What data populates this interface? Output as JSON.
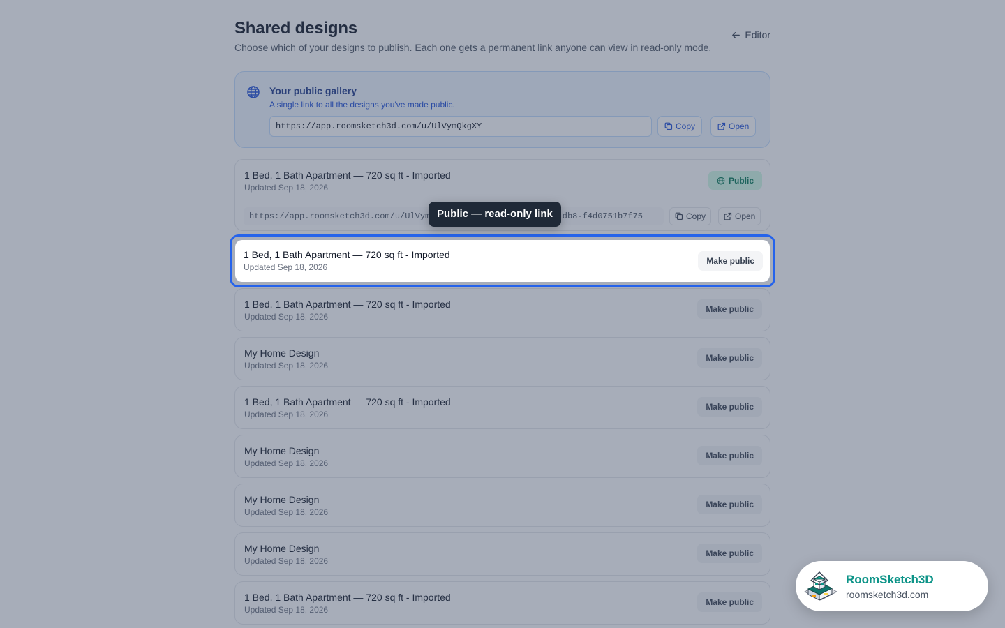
{
  "header": {
    "title": "Shared designs",
    "subtitle": "Choose which of your designs to publish. Each one gets a permanent link anyone can view in read-only mode.",
    "editor_link": "Editor"
  },
  "gallery": {
    "title": "Your public gallery",
    "description": "A single link to all the designs you've made public.",
    "url": "https://app.roomsketch3d.com/u/UlVymQkgXY",
    "copy_label": "Copy",
    "open_label": "Open"
  },
  "designs": [
    {
      "title": "1 Bed, 1 Bath Apartment — 720 sq ft - Imported",
      "updated": "Updated Sep 18, 2026",
      "status": "Public",
      "share_url_start": "https://app.roomsketch3d.com/u/UlVym",
      "share_url_end": "db8-f4d0751b7f75",
      "copy_label": "Copy",
      "open_label": "Open"
    },
    {
      "title": "1 Bed, 1 Bath Apartment — 720 sq ft - Imported",
      "updated": "Updated Sep 18, 2026",
      "action": "Make public"
    },
    {
      "title": "1 Bed, 1 Bath Apartment — 720 sq ft - Imported",
      "updated": "Updated Sep 18, 2026",
      "action": "Make public"
    },
    {
      "title": "My Home Design",
      "updated": "Updated Sep 18, 2026",
      "action": "Make public"
    },
    {
      "title": "1 Bed, 1 Bath Apartment — 720 sq ft - Imported",
      "updated": "Updated Sep 18, 2026",
      "action": "Make public"
    },
    {
      "title": "My Home Design",
      "updated": "Updated Sep 18, 2026",
      "action": "Make public"
    },
    {
      "title": "My Home Design",
      "updated": "Updated Sep 18, 2026",
      "action": "Make public"
    },
    {
      "title": "My Home Design",
      "updated": "Updated Sep 18, 2026",
      "action": "Make public"
    },
    {
      "title": "1 Bed, 1 Bath Apartment — 720 sq ft - Imported",
      "updated": "Updated Sep 18, 2026",
      "action": "Make public"
    }
  ],
  "tooltip": {
    "text": "Public — read-only link"
  },
  "brand": {
    "name": "RoomSketch3D",
    "url": "roomsketch3d.com",
    "logo_icon": "house-logo-icon"
  },
  "icons": {
    "editor": "arrow-left-icon",
    "gallery": "globe-icon",
    "copy": "copy-icon",
    "open": "external-link-icon",
    "public": "globe-icon"
  },
  "colors": {
    "accent": "#2563eb",
    "public_badge_bg": "#d1fae5",
    "public_badge_text": "#047857",
    "brand": "#0d9488",
    "overlay": "#3c4a64"
  }
}
